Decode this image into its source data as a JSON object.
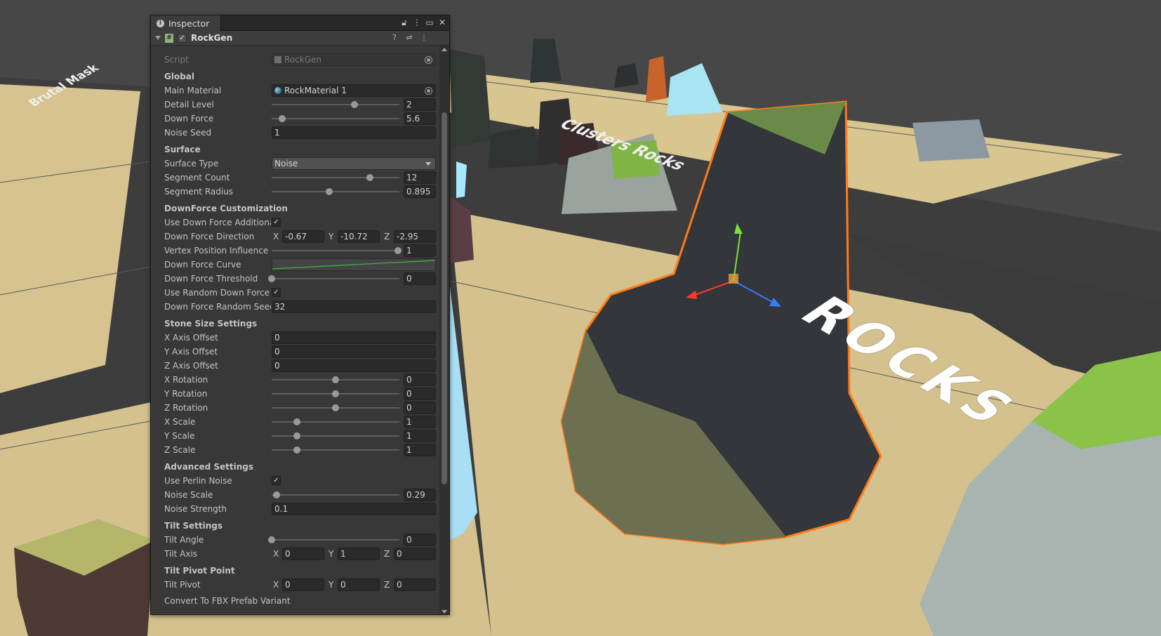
{
  "scene": {
    "rocks_text": "ROCKS",
    "cluster_text": "Clusters Rocks",
    "left_text": "Brutal Mask"
  },
  "inspector": {
    "tab_title": "Inspector",
    "component_name": "RockGen",
    "script": {
      "label": "Script",
      "value": "RockGen"
    },
    "global": {
      "header": "Global",
      "main_material": {
        "label": "Main Material",
        "value": "RockMaterial 1"
      },
      "detail_level": {
        "label": "Detail Level",
        "value": "2",
        "slider": 0.65
      },
      "down_force": {
        "label": "Down Force",
        "value": "5.6",
        "slider": 0.08
      },
      "noise_seed": {
        "label": "Noise Seed",
        "value": "1"
      }
    },
    "surface": {
      "header": "Surface",
      "surface_type": {
        "label": "Surface Type",
        "value": "Noise"
      },
      "segment_count": {
        "label": "Segment Count",
        "value": "12",
        "slider": 0.77
      },
      "segment_radius": {
        "label": "Segment Radius",
        "value": "0.895",
        "slider": 0.45
      }
    },
    "downforce": {
      "header": "DownForce Customization",
      "use_additional": {
        "label": "Use Down Force Additiona",
        "checked": true
      },
      "direction": {
        "label": "Down Force Direction",
        "x": "-0.67",
        "y": "-10.72",
        "z": "-2.95"
      },
      "vertex_influence": {
        "label": "Vertex Position Influence",
        "value": "1",
        "slider": 0.99
      },
      "curve": {
        "label": "Down Force Curve",
        "color": "#3fb93f"
      },
      "threshold": {
        "label": "Down Force Threshold",
        "value": "0",
        "slider": 0.0
      },
      "use_random": {
        "label": "Use Random Down Force D",
        "checked": true
      },
      "random_seed": {
        "label": "Down Force Random Seed",
        "value": "32"
      }
    },
    "stone_size": {
      "header": "Stone Size Settings",
      "x_offset": {
        "label": "X Axis Offset",
        "value": "0"
      },
      "y_offset": {
        "label": "Y Axis Offset",
        "value": "0"
      },
      "z_offset": {
        "label": "Z Axis Offset",
        "value": "0"
      },
      "x_rotation": {
        "label": "X Rotation",
        "value": "0",
        "slider": 0.5
      },
      "y_rotation": {
        "label": "Y Rotation",
        "value": "0",
        "slider": 0.5
      },
      "z_rotation": {
        "label": "Z Rotation",
        "value": "0",
        "slider": 0.5
      },
      "x_scale": {
        "label": "X Scale",
        "value": "1",
        "slider": 0.2
      },
      "y_scale": {
        "label": "Y Scale",
        "value": "1",
        "slider": 0.2
      },
      "z_scale": {
        "label": "Z Scale",
        "value": "1",
        "slider": 0.2
      }
    },
    "advanced": {
      "header": "Advanced Settings",
      "use_perlin": {
        "label": "Use Perlin Noise",
        "checked": true
      },
      "noise_scale": {
        "label": "Noise Scale",
        "value": "0.29",
        "slider": 0.04
      },
      "noise_strength": {
        "label": "Noise Strength",
        "value": "0.1"
      }
    },
    "tilt": {
      "header": "Tilt Settings",
      "angle": {
        "label": "Tilt Angle",
        "value": "0",
        "slider": 0.0
      },
      "axis": {
        "label": "Tilt Axis",
        "x": "0",
        "y": "1",
        "z": "0"
      }
    },
    "tilt_pivot": {
      "header": "Tilt Pivot Point",
      "pivot": {
        "label": "Tilt Pivot",
        "x": "0",
        "y": "0",
        "z": "0"
      }
    },
    "footer_button": "Convert To FBX Prefab Variant",
    "vec_labels": {
      "x": "X",
      "y": "Y",
      "z": "Z"
    }
  },
  "colors": {
    "selection_outline": "#ff7a1a",
    "ground": "#d6c38f",
    "grid": "#3c3c3c"
  }
}
